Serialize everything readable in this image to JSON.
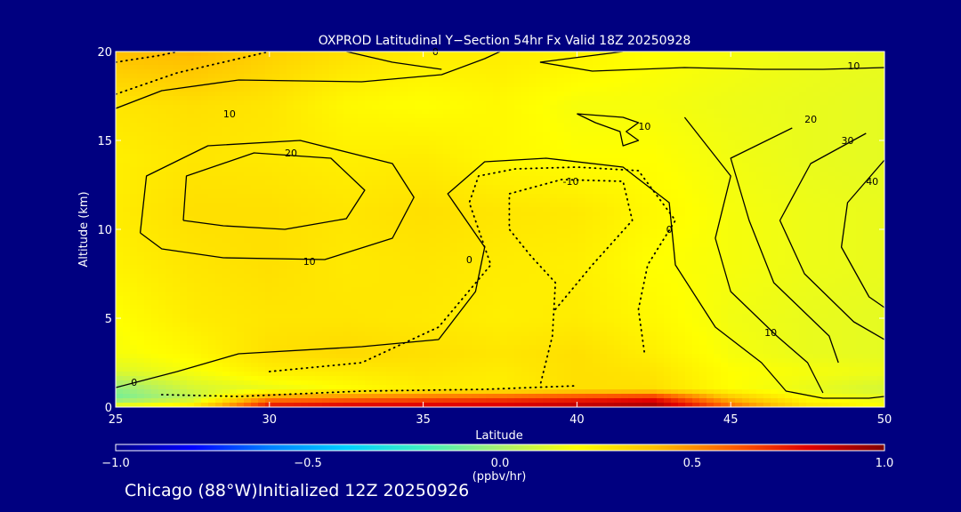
{
  "chart_data": {
    "type": "heatmap",
    "title": "OXPROD Latitudinal Y−Section 54hr  Fx Valid 18Z 20250928",
    "xlabel": "Latitude",
    "ylabel": "Altitude (km)",
    "xlim": [
      25,
      50
    ],
    "ylim": [
      0,
      20
    ],
    "x_ticks": [
      25,
      30,
      35,
      40,
      45,
      50
    ],
    "y_ticks": [
      0,
      5,
      10,
      15,
      20
    ],
    "colorbar": {
      "label": "(ppbv/hr)",
      "range": [
        -1.0,
        1.0
      ],
      "tick_values": [
        -1.0,
        -0.5,
        0.0,
        0.5,
        1.0
      ],
      "tick_labels": [
        "−1.0",
        "−0.5",
        "0.0",
        "0.5",
        "1.0"
      ],
      "stops": [
        "#00008b",
        "#0000ff",
        "#0080ff",
        "#00d0ff",
        "#40f0c0",
        "#a8f070",
        "#ffff00",
        "#ffc000",
        "#ff6000",
        "#e00000",
        "#800000"
      ]
    },
    "field_grid": {
      "lat": [
        25,
        27.5,
        30,
        32.5,
        35,
        37.5,
        40,
        42.5,
        45,
        47.5,
        50
      ],
      "alt": [
        0,
        0.5,
        1,
        2,
        3,
        5,
        8,
        11,
        14,
        17,
        20
      ],
      "values": [
        [
          0.2,
          0.3,
          0.8,
          0.85,
          0.85,
          0.85,
          0.9,
          0.95,
          0.6,
          0.3,
          0.2
        ],
        [
          -0.1,
          0.05,
          0.5,
          0.55,
          0.6,
          0.65,
          0.7,
          0.75,
          0.4,
          0.2,
          0.15
        ],
        [
          -0.05,
          0.1,
          0.15,
          0.2,
          0.25,
          0.25,
          0.3,
          0.3,
          0.2,
          0.15,
          0.1
        ],
        [
          0.12,
          0.18,
          0.25,
          0.26,
          0.28,
          0.26,
          0.3,
          0.28,
          0.2,
          0.18,
          0.16
        ],
        [
          0.18,
          0.22,
          0.3,
          0.32,
          0.3,
          0.28,
          0.3,
          0.25,
          0.18,
          0.15,
          0.14
        ],
        [
          0.2,
          0.26,
          0.28,
          0.28,
          0.27,
          0.25,
          0.26,
          0.22,
          0.17,
          0.15,
          0.14
        ],
        [
          0.24,
          0.28,
          0.3,
          0.27,
          0.28,
          0.26,
          0.25,
          0.2,
          0.18,
          0.16,
          0.15
        ],
        [
          0.26,
          0.3,
          0.3,
          0.28,
          0.3,
          0.28,
          0.27,
          0.22,
          0.18,
          0.16,
          0.15
        ],
        [
          0.25,
          0.28,
          0.27,
          0.25,
          0.26,
          0.22,
          0.2,
          0.2,
          0.17,
          0.15,
          0.14
        ],
        [
          0.28,
          0.3,
          0.28,
          0.22,
          0.2,
          0.22,
          0.18,
          0.18,
          0.16,
          0.15,
          0.14
        ],
        [
          0.4,
          0.42,
          0.35,
          0.3,
          0.26,
          0.26,
          0.24,
          0.2,
          0.18,
          0.16,
          0.15
        ]
      ]
    },
    "contours": [
      {
        "label": "0",
        "dotted": false,
        "points": [
          [
            25,
            1.1
          ],
          [
            27,
            2.0
          ],
          [
            29,
            3.0
          ],
          [
            33,
            3.4
          ],
          [
            35.5,
            3.8
          ],
          [
            36.7,
            6.5
          ],
          [
            37,
            9.0
          ],
          [
            35.8,
            12.0
          ],
          [
            37,
            13.8
          ],
          [
            39,
            14.0
          ],
          [
            41.5,
            13.5
          ],
          [
            43,
            11.5
          ],
          [
            43.2,
            8.0
          ],
          [
            44.5,
            4.5
          ],
          [
            46,
            2.5
          ],
          [
            46.8,
            0.9
          ],
          [
            48,
            0.5
          ],
          [
            49.5,
            0.5
          ],
          [
            50,
            0.6
          ]
        ]
      },
      {
        "label": "0",
        "dotted": false,
        "points": [
          [
            38.8,
            19.4
          ],
          [
            41.5,
            20
          ]
        ]
      },
      {
        "label": "0",
        "dotted": false,
        "points": [
          [
            35.6,
            19.0
          ],
          [
            34,
            19.4
          ],
          [
            32.5,
            20
          ]
        ]
      },
      {
        "label": "10",
        "dotted": false,
        "points": [
          [
            25,
            16.8
          ],
          [
            26.5,
            17.8
          ],
          [
            29,
            18.4
          ],
          [
            33,
            18.3
          ],
          [
            35.6,
            18.7
          ],
          [
            37,
            19.6
          ],
          [
            37.5,
            20
          ]
        ]
      },
      {
        "label": "10",
        "dotted": false,
        "points": [
          [
            25.8,
            9.8
          ],
          [
            26,
            13.0
          ],
          [
            28,
            14.7
          ],
          [
            31,
            15.0
          ],
          [
            34,
            13.7
          ],
          [
            34.7,
            11.8
          ],
          [
            34.0,
            9.5
          ],
          [
            31.8,
            8.3
          ],
          [
            28.5,
            8.4
          ],
          [
            26.5,
            8.9
          ],
          [
            25.8,
            9.8
          ]
        ]
      },
      {
        "label": "10",
        "dotted": false,
        "points": [
          [
            38.8,
            19.4
          ],
          [
            40.5,
            18.9
          ],
          [
            43.5,
            19.1
          ],
          [
            46,
            19.0
          ],
          [
            48,
            19.0
          ],
          [
            50,
            19.1
          ]
        ]
      },
      {
        "label": "10",
        "dotted": false,
        "points": [
          [
            40,
            16.5
          ],
          [
            41.5,
            16.3
          ],
          [
            42,
            16.0
          ],
          [
            41.6,
            15.5
          ],
          [
            42,
            15.0
          ],
          [
            41.5,
            14.7
          ],
          [
            41.4,
            15.5
          ],
          [
            40.6,
            16.0
          ],
          [
            40,
            16.5
          ]
        ]
      },
      {
        "label": "10",
        "dotted": false,
        "points": [
          [
            43.5,
            16.3
          ],
          [
            45,
            13.0
          ],
          [
            44.5,
            9.5
          ],
          [
            45,
            6.5
          ],
          [
            46.5,
            4.0
          ],
          [
            47.5,
            2.5
          ],
          [
            48,
            0.8
          ]
        ]
      },
      {
        "label": "20",
        "dotted": false,
        "points": [
          [
            27.2,
            10.5
          ],
          [
            27.3,
            13.0
          ],
          [
            29.5,
            14.3
          ],
          [
            32,
            14.0
          ],
          [
            33.1,
            12.2
          ],
          [
            32.5,
            10.6
          ],
          [
            30.5,
            10.0
          ],
          [
            28.5,
            10.2
          ],
          [
            27.2,
            10.5
          ]
        ]
      },
      {
        "label": "20",
        "dotted": false,
        "points": [
          [
            47,
            15.7
          ],
          [
            45,
            14.0
          ],
          [
            45.6,
            10.5
          ],
          [
            46.4,
            7.0
          ],
          [
            48.2,
            4.0
          ],
          [
            48.5,
            2.5
          ]
        ]
      },
      {
        "label": "30",
        "dotted": false,
        "points": [
          [
            49.4,
            15.4
          ],
          [
            47.6,
            13.7
          ],
          [
            46.6,
            10.5
          ],
          [
            47.4,
            7.5
          ],
          [
            49,
            4.8
          ],
          [
            50,
            3.8
          ]
        ]
      },
      {
        "label": "40",
        "dotted": false,
        "points": [
          [
            50,
            13.9
          ],
          [
            48.8,
            11.5
          ],
          [
            48.6,
            9.0
          ],
          [
            49.5,
            6.2
          ],
          [
            50,
            5.6
          ]
        ]
      },
      {
        "label": "",
        "dotted": true,
        "points": [
          [
            25,
            17.6
          ],
          [
            27,
            18.8
          ],
          [
            29,
            19.6
          ],
          [
            30,
            20
          ]
        ]
      },
      {
        "label": "",
        "dotted": true,
        "points": [
          [
            25,
            19.4
          ],
          [
            26.5,
            19.8
          ],
          [
            27,
            20
          ]
        ]
      },
      {
        "label": "",
        "dotted": true,
        "points": [
          [
            30,
            2.0
          ],
          [
            33,
            2.5
          ],
          [
            35.5,
            4.5
          ],
          [
            37.2,
            8.0
          ],
          [
            36.5,
            11.5
          ],
          [
            36.8,
            13.0
          ],
          [
            38,
            13.4
          ],
          [
            40,
            13.5
          ],
          [
            42,
            13.3
          ],
          [
            43.2,
            10.5
          ],
          [
            42.3,
            8.0
          ],
          [
            42,
            5.5
          ],
          [
            42.2,
            3.0
          ]
        ]
      },
      {
        "label": "",
        "dotted": true,
        "points": [
          [
            26.5,
            0.7
          ],
          [
            29,
            0.6
          ],
          [
            33,
            0.9
          ],
          [
            37,
            1.0
          ],
          [
            40,
            1.2
          ]
        ]
      },
      {
        "label": "-10",
        "dotted": true,
        "points": [
          [
            39.3,
            5.5
          ],
          [
            40.5,
            8.0
          ],
          [
            41.8,
            10.5
          ],
          [
            41.5,
            12.7
          ],
          [
            39.5,
            12.8
          ],
          [
            37.8,
            12.0
          ],
          [
            37.8,
            10.0
          ],
          [
            38.5,
            8.5
          ],
          [
            39.3,
            7.0
          ],
          [
            39.2,
            4.0
          ],
          [
            38.8,
            1.2
          ]
        ]
      }
    ],
    "contour_labels": [
      {
        "text": "0",
        "lat": 35.4,
        "alt": 20.0
      },
      {
        "text": "10",
        "lat": 49.0,
        "alt": 19.2
      },
      {
        "text": "10",
        "lat": 28.7,
        "alt": 16.5
      },
      {
        "text": "20",
        "lat": 30.7,
        "alt": 14.3
      },
      {
        "text": "20",
        "lat": 47.6,
        "alt": 16.2
      },
      {
        "text": "30",
        "lat": 48.8,
        "alt": 15.0
      },
      {
        "text": "40",
        "lat": 49.6,
        "alt": 12.7
      },
      {
        "text": "10",
        "lat": 42.2,
        "alt": 15.8
      },
      {
        "text": "-10",
        "lat": 39.8,
        "alt": 12.7
      },
      {
        "text": "10",
        "lat": 31.3,
        "alt": 8.2
      },
      {
        "text": "0",
        "lat": 36.5,
        "alt": 8.3
      },
      {
        "text": "0",
        "lat": 43.0,
        "alt": 10.0
      },
      {
        "text": "10",
        "lat": 46.3,
        "alt": 4.2
      },
      {
        "text": "0",
        "lat": 25.6,
        "alt": 1.4
      }
    ]
  },
  "footer": {
    "text": "Chicago (88°W)Initialized 12Z 20250926"
  }
}
